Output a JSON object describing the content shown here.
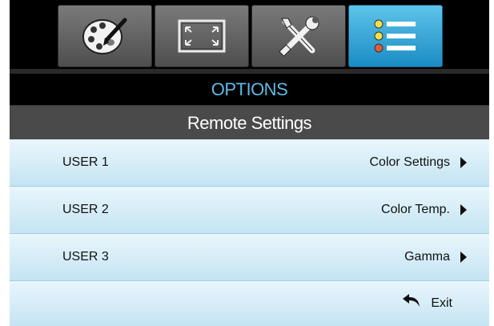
{
  "tabs": [
    {
      "icon": "palette-icon",
      "active": false
    },
    {
      "icon": "screen-resize-icon",
      "active": false
    },
    {
      "icon": "tools-icon",
      "active": false
    },
    {
      "icon": "options-list-icon",
      "active": true
    }
  ],
  "header": {
    "title": "OPTIONS"
  },
  "submenu": {
    "title": "Remote Settings"
  },
  "rows": [
    {
      "label": "USER 1",
      "value": "Color Settings"
    },
    {
      "label": "USER 2",
      "value": "Color Temp."
    },
    {
      "label": "USER 3",
      "value": "Gamma"
    }
  ],
  "exit": {
    "label": "Exit"
  },
  "colors": {
    "accent": "#5fb9e6",
    "active_tab": "#2a9fd6",
    "row_bg": "#d9eef8",
    "subheader_bg": "#4a4a4a"
  }
}
